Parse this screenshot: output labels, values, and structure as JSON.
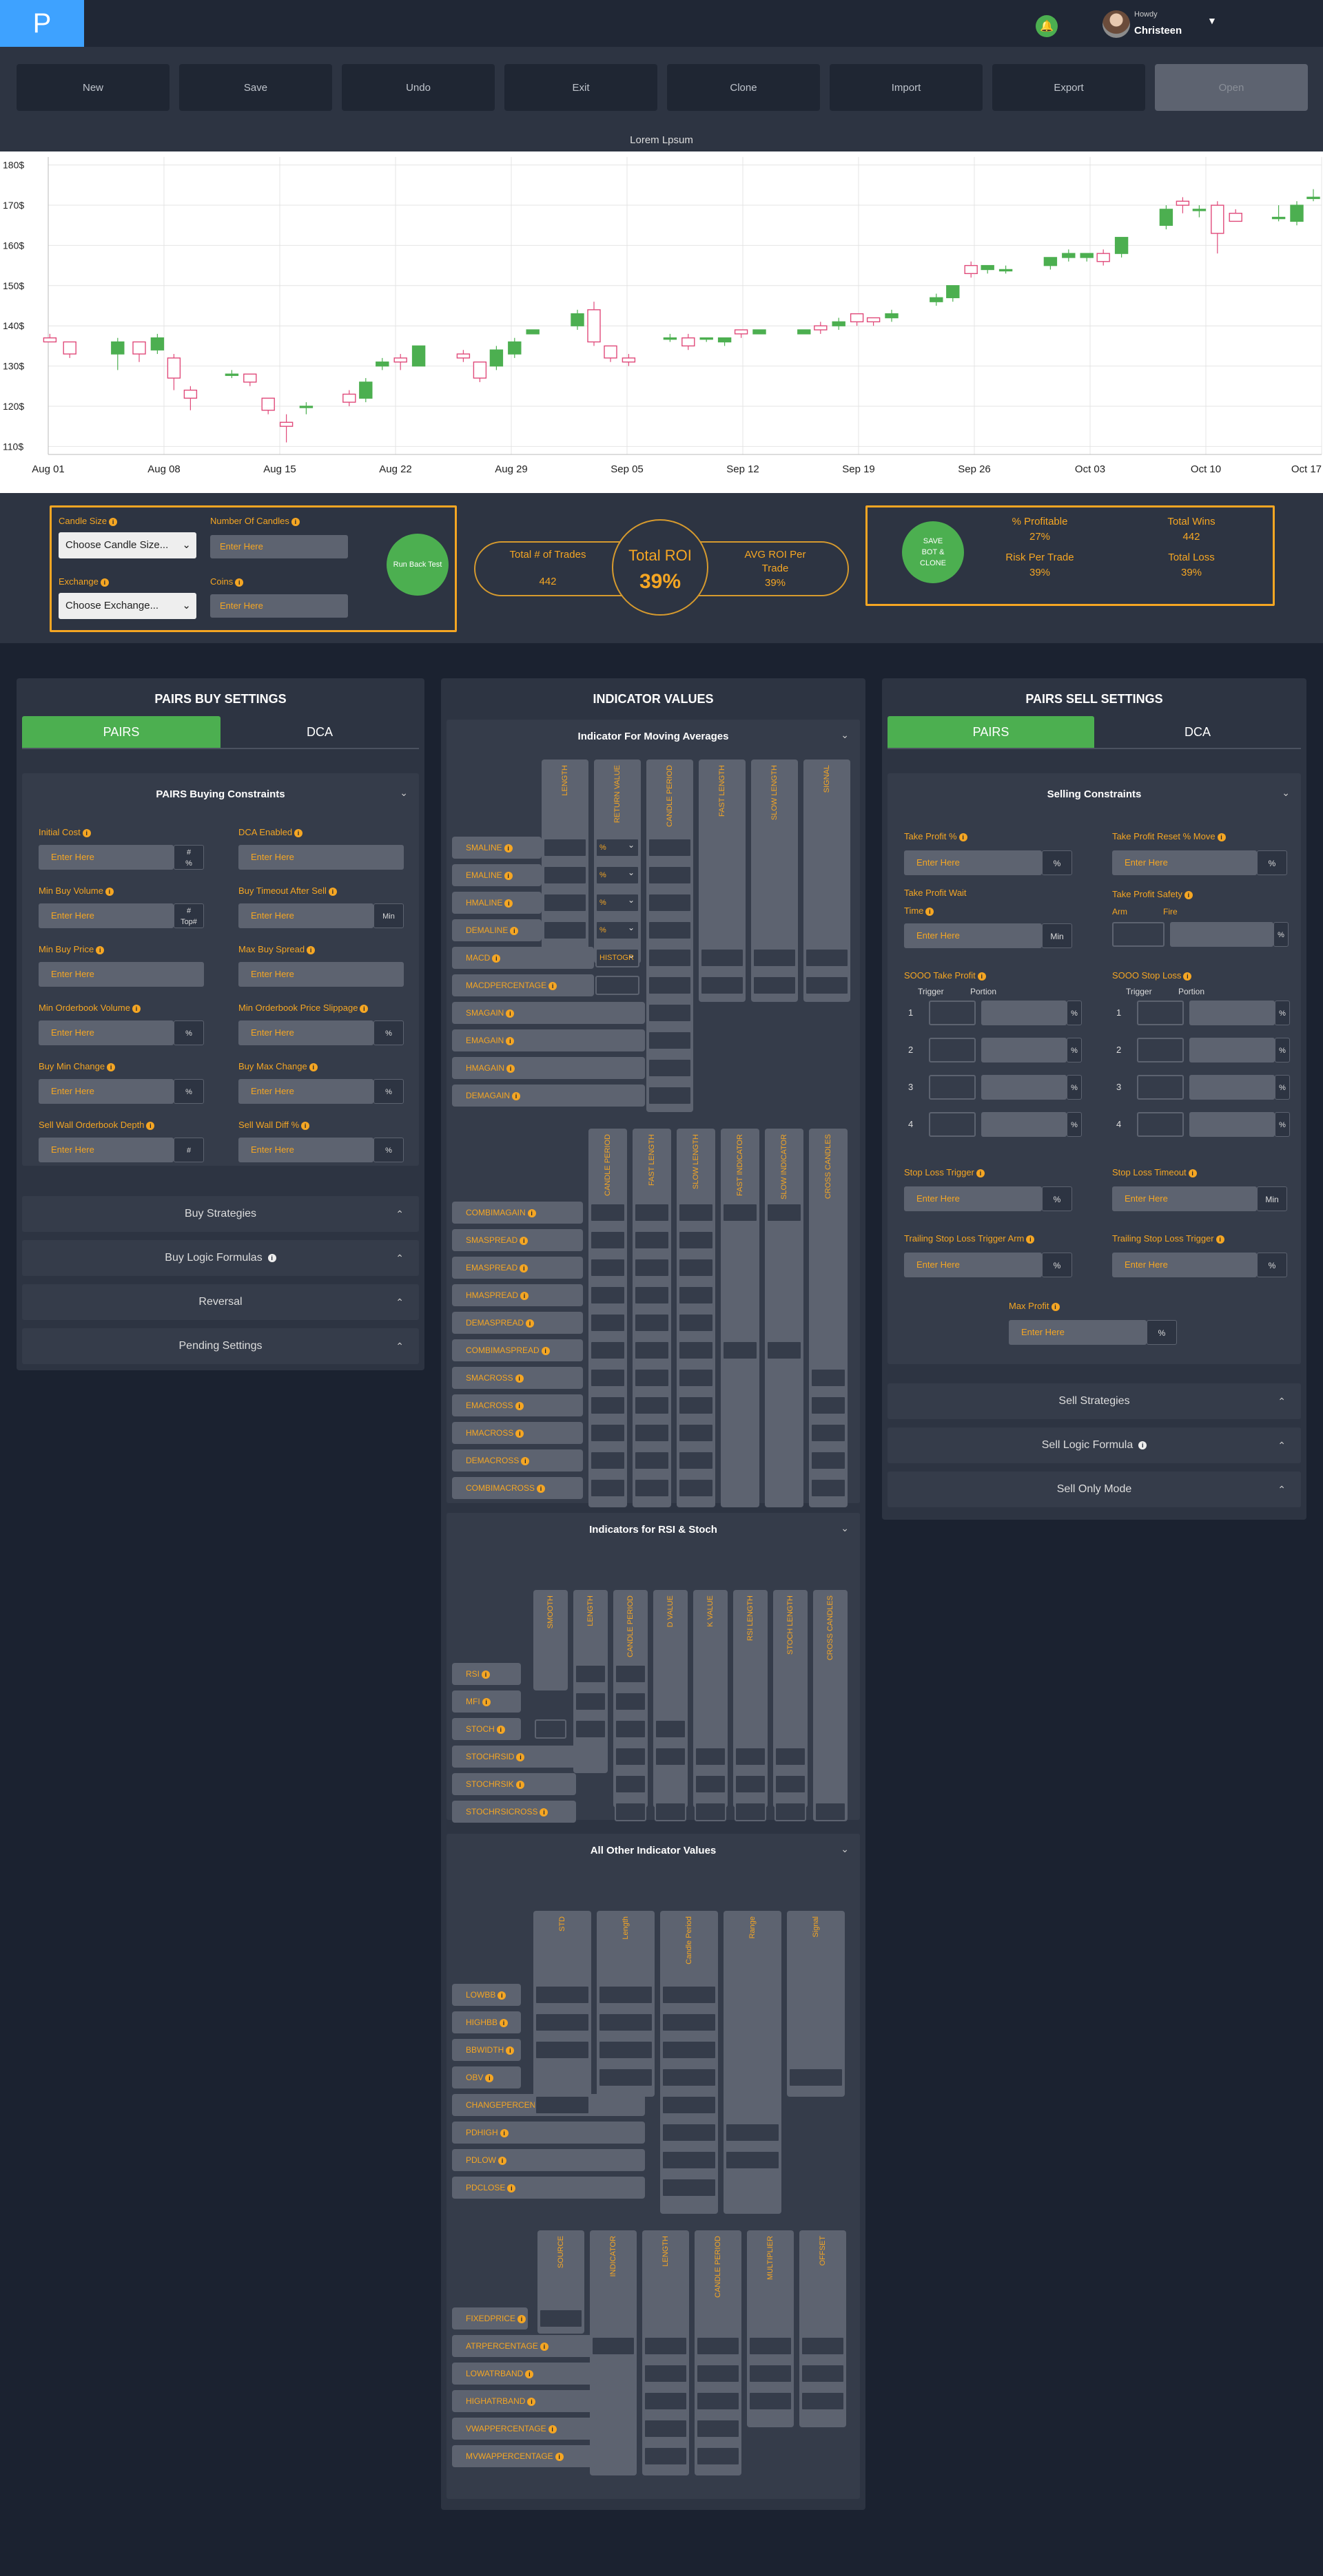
{
  "header": {
    "logo": "P",
    "howdy": "Howdy",
    "user": "Christeen"
  },
  "toolbar": [
    "New",
    "Save",
    "Undo",
    "Exit",
    "Clone",
    "Import",
    "Export",
    "Open"
  ],
  "chart_data": {
    "type": "candlestick",
    "title": "Lorem Lpsum",
    "y_ticks": [
      "180$",
      "170$",
      "160$",
      "150$",
      "140$",
      "130$",
      "120$",
      "110$"
    ],
    "ylim": [
      108,
      182
    ],
    "x_ticks": [
      "Aug 01",
      "Aug 08",
      "Aug 15",
      "Aug 22",
      "Aug 29",
      "Sep 05",
      "Sep 12",
      "Sep 19",
      "Sep 26",
      "Oct 03",
      "Oct 10",
      "Oct 17"
    ],
    "up_color": "#4caf50",
    "down_color": "#e04a7a",
    "candles": [
      [
        0.1,
        137,
        136,
        138,
        136
      ],
      [
        1.3,
        136,
        133,
        136,
        132
      ],
      [
        4.2,
        133,
        136,
        137,
        129
      ],
      [
        5.5,
        136,
        133,
        135,
        131
      ],
      [
        6.6,
        134,
        137,
        138,
        133
      ],
      [
        7.6,
        132,
        127,
        133,
        124
      ],
      [
        8.6,
        124,
        122,
        125,
        119
      ],
      [
        11.1,
        128,
        128,
        129,
        127
      ],
      [
        12.2,
        128,
        126,
        128,
        125
      ],
      [
        13.3,
        122,
        119,
        122,
        118
      ],
      [
        14.4,
        116,
        115,
        118,
        111
      ],
      [
        15.6,
        120,
        120,
        121,
        118
      ],
      [
        18.2,
        123,
        121,
        124,
        120
      ],
      [
        19.2,
        122,
        126,
        127,
        121
      ],
      [
        20.2,
        130,
        131,
        132,
        129
      ],
      [
        21.3,
        132,
        131,
        133,
        129
      ],
      [
        22.4,
        130,
        135,
        135,
        130
      ],
      [
        25.1,
        133,
        132,
        134,
        131
      ],
      [
        26.1,
        131,
        127,
        131,
        126
      ],
      [
        27.1,
        130,
        134,
        135,
        129
      ],
      [
        28.2,
        133,
        136,
        137,
        132
      ],
      [
        29.3,
        138,
        139,
        139,
        138
      ],
      [
        32.0,
        140,
        143,
        144,
        139
      ],
      [
        33.0,
        144,
        136,
        146,
        135
      ],
      [
        34.0,
        135,
        132,
        135,
        131
      ],
      [
        35.1,
        132,
        131,
        133,
        130
      ],
      [
        37.6,
        137,
        137,
        138,
        136
      ],
      [
        38.7,
        137,
        135,
        138,
        134
      ],
      [
        39.8,
        137,
        137,
        137,
        136
      ],
      [
        40.9,
        136,
        137,
        137,
        135
      ],
      [
        41.9,
        139,
        138,
        139,
        137
      ],
      [
        43.0,
        138,
        139,
        139,
        138
      ],
      [
        45.7,
        138,
        139,
        139,
        138
      ],
      [
        46.7,
        140,
        139,
        141,
        138
      ],
      [
        47.8,
        140,
        141,
        142,
        139
      ],
      [
        48.9,
        143,
        141,
        143,
        140
      ],
      [
        49.9,
        142,
        141,
        142,
        140
      ],
      [
        51.0,
        142,
        143,
        144,
        141
      ],
      [
        53.7,
        146,
        147,
        148,
        145
      ],
      [
        54.7,
        147,
        150,
        150,
        146
      ],
      [
        55.8,
        155,
        153,
        156,
        152
      ],
      [
        56.8,
        154,
        155,
        155,
        153
      ],
      [
        57.9,
        154,
        154,
        155,
        153
      ],
      [
        60.6,
        155,
        157,
        157,
        154
      ],
      [
        61.7,
        157,
        158,
        159,
        156
      ],
      [
        62.8,
        157,
        158,
        158,
        156
      ],
      [
        63.8,
        158,
        156,
        159,
        155
      ],
      [
        64.9,
        158,
        162,
        162,
        157
      ],
      [
        67.6,
        165,
        169,
        170,
        164
      ],
      [
        68.6,
        171,
        170,
        172,
        168
      ],
      [
        69.6,
        169,
        169,
        170,
        167
      ],
      [
        70.7,
        170,
        163,
        171,
        158
      ],
      [
        71.8,
        168,
        166,
        169,
        166
      ],
      [
        74.4,
        167,
        167,
        170,
        166
      ],
      [
        75.5,
        166,
        170,
        171,
        165
      ],
      [
        76.5,
        172,
        172,
        174,
        171
      ]
    ]
  },
  "backtest": {
    "candle_size_label": "Candle Size",
    "candle_size_value": "Choose Candle Size...",
    "num_candles_label": "Number Of Candles",
    "num_candles_placeholder": "Enter Here",
    "exchange_label": "Exchange",
    "exchange_value": "Choose Exchange...",
    "coins_label": "Coins",
    "coins_placeholder": "Enter Here",
    "run_button": "Run Back Test",
    "total_trades_label": "Total # of Trades",
    "total_trades": "442",
    "total_roi_label": "Total ROI",
    "total_roi": "39%",
    "avg_roi_label": "AVG ROI Per Trade",
    "avg_roi": "39%",
    "save_button": "SAVE BOT & CLONE",
    "pct_profitable_label": "% Profitable",
    "pct_profitable": "27%",
    "total_wins_label": "Total Wins",
    "total_wins": "442",
    "risk_label": "Risk Per Trade",
    "risk": "39%",
    "total_loss_label": "Total Loss",
    "total_loss": "39%"
  },
  "buy": {
    "title": "PAIRS BUY SETTINGS",
    "tab_pairs": "PAIRS",
    "tab_dca": "DCA",
    "constraints_title": "PAIRS Buying Constraints",
    "placeholder": "Enter Here",
    "fields": [
      {
        "label": "Initial Cost",
        "unit": "#\n%"
      },
      {
        "label": "DCA Enabled",
        "unit": ""
      },
      {
        "label": "Min Buy Volume",
        "unit": "#\nTop#"
      },
      {
        "label": "Buy Timeout After Sell",
        "unit": "Min"
      },
      {
        "label": "Min Buy Price",
        "unit": ""
      },
      {
        "label": "Max Buy Spread",
        "unit": ""
      },
      {
        "label": "Min Orderbook Volume",
        "unit": "%"
      },
      {
        "label": "Min Orderbook Price Slippage",
        "unit": "%"
      },
      {
        "label": "Buy Min Change",
        "unit": "%"
      },
      {
        "label": "Buy Max Change",
        "unit": "%"
      },
      {
        "label": "Sell Wall Orderbook Depth",
        "unit": "#"
      },
      {
        "label": "Sell Wall Diff %",
        "unit": "%"
      }
    ],
    "sections": [
      "Buy Strategies",
      "Buy Logic Formulas",
      "Reversal",
      "Pending Settings"
    ]
  },
  "indicators": {
    "title": "INDICATOR VALUES",
    "ma_title": "Indicator For Moving Averages",
    "ma_cols": [
      "LENGTH",
      "RETURN VALUE",
      "CANDLE PERIOD",
      "FAST LENGTH",
      "SLOW LENGTH",
      "SIGNAL"
    ],
    "ma_rows": [
      "SMALINE",
      "EMALINE",
      "HMALINE",
      "DEMALINE",
      "MACD",
      "MACDPERCENTAGE",
      "SMAGAIN",
      "EMAGAIN",
      "HMAGAIN",
      "DEMAGAIN"
    ],
    "ma_select": "%",
    "macd_select": "HISTOGR",
    "cross_cols": [
      "CANDLE PERIOD",
      "FAST LENGTH",
      "SLOW LENGTH",
      "FAST INDICATOR",
      "SLOW INDICATOR",
      "CROSS CANDLES"
    ],
    "cross_rows": [
      "COMBIMAGAIN",
      "SMASPREAD",
      "EMASPREAD",
      "HMASPREAD",
      "DEMASPREAD",
      "COMBIMASPREAD",
      "SMACROSS",
      "EMACROSS",
      "HMACROSS",
      "DEMACROSS",
      "COMBIMACROSS"
    ],
    "rsi_title": "Indicators for RSI & Stoch",
    "rsi_cols": [
      "SMOOTH",
      "LENGTH",
      "CANDLE PERIOD",
      "D VALUE",
      "K VALUE",
      "RSI LENGTH",
      "STOCH LENGTH",
      "CROSS CANDLES"
    ],
    "rsi_rows": [
      "RSI",
      "MFI",
      "STOCH",
      "STOCHRSID",
      "STOCHRSIK",
      "STOCHRSICROSS"
    ],
    "other_title": "All Other Indicator Values",
    "other_cols": [
      "STD",
      "Length",
      "Candle Period",
      "Range",
      "Signal"
    ],
    "other_rows": [
      "LOWBB",
      "HIGHBB",
      "BBWIDTH",
      "OBV",
      "CHANGEPERCENTAGE",
      "PDHIGH",
      "PDLOW",
      "PDCLOSE"
    ],
    "atr_cols": [
      "SOURCE",
      "INDICATOR",
      "LENGTH",
      "CANDLE PERIOD",
      "MULTIPLIER",
      "OFFSET"
    ],
    "atr_rows": [
      "FIXEDPRICE",
      "ATRPERCENTAGE",
      "LOWATRBAND",
      "HIGHATRBAND",
      "VWAPPERCENTAGE",
      "MVWAPPERCENTAGE"
    ]
  },
  "sell": {
    "title": "PAIRS SELL SETTINGS",
    "tab_pairs": "PAIRS",
    "tab_dca": "DCA",
    "constraints_title": "Selling Constraints",
    "placeholder": "Enter Here",
    "take_profit": "Take Profit %",
    "take_profit_reset": "Take Profit Reset % Move",
    "tp_wait_1": "Take Profit Wait",
    "tp_wait_2": "Time",
    "tp_safety": "Take Profit Safety",
    "arm": "Arm",
    "fire": "Fire",
    "sooo_tp": "SOOO Take Profit",
    "sooo_sl": "SOOO Stop Loss",
    "trigger": "Trigger",
    "portion": "Portion",
    "rows": [
      "1",
      "2",
      "3",
      "4"
    ],
    "stop_loss_trigger": "Stop Loss Trigger",
    "stop_loss_timeout": "Stop Loss Timeout",
    "trailing_arm": "Trailing Stop Loss Trigger Arm",
    "trailing_trigger": "Trailing Stop Loss Trigger",
    "max_profit": "Max Profit",
    "sections": [
      "Sell Strategies",
      "Sell Logic Formula",
      "Sell Only Mode"
    ]
  }
}
